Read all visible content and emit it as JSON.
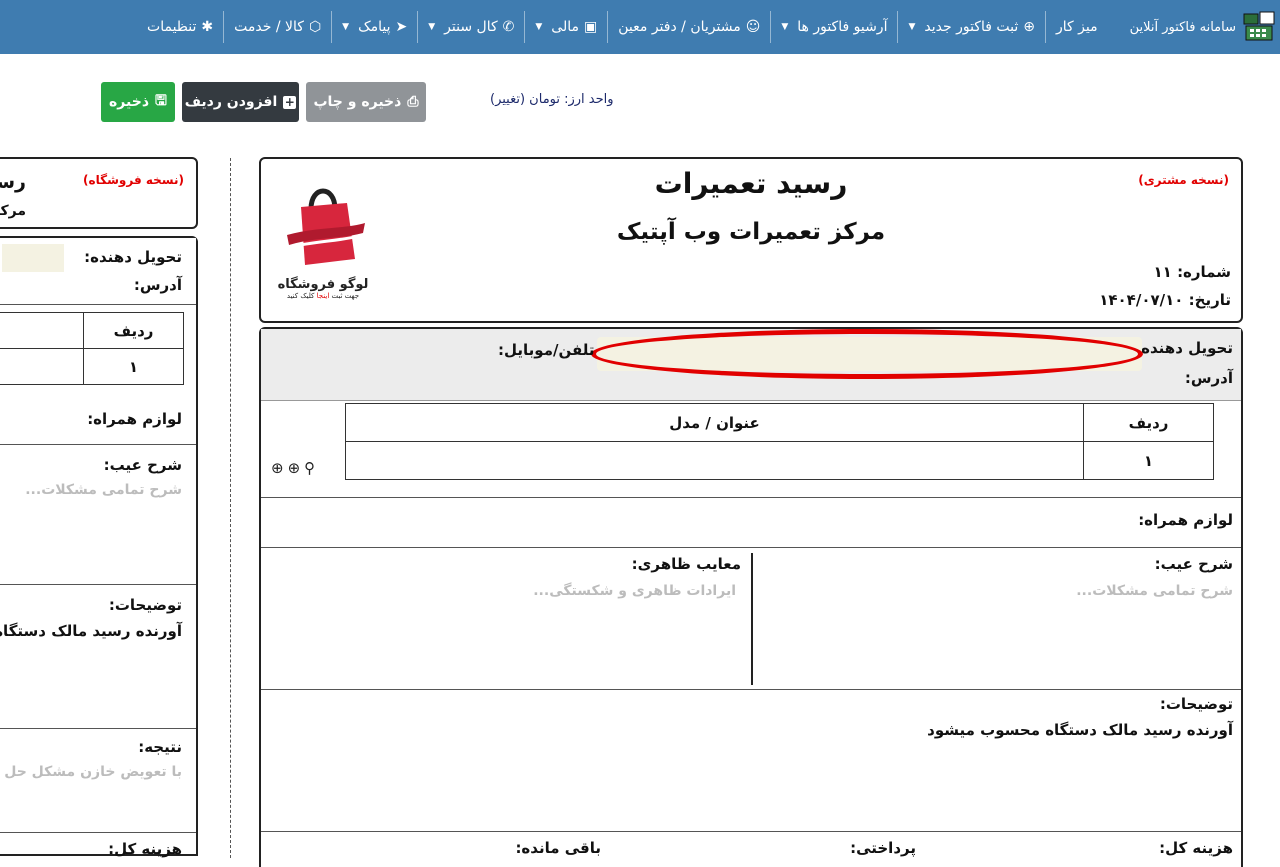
{
  "navbar": {
    "brand": "سامانه فاکتور آنلاین",
    "items": [
      {
        "label": "میز کار",
        "icon": "",
        "caret": false
      },
      {
        "label": "ثبت فاکتور جدید",
        "icon": "⊕",
        "caret": true
      },
      {
        "label": "آرشیو فاکتور ها",
        "icon": "",
        "caret": true
      },
      {
        "label": "مشتریان / دفتر معین",
        "icon": "☺",
        "caret": false
      },
      {
        "label": "مالی",
        "icon": "▣",
        "caret": true
      },
      {
        "label": "کال سنتر",
        "icon": "✆",
        "caret": true
      },
      {
        "label": "پیامک",
        "icon": "➤",
        "caret": true
      },
      {
        "label": "کالا / خدمت",
        "icon": "⬡",
        "caret": false
      },
      {
        "label": "تنظیمات",
        "icon": "✱",
        "caret": false
      }
    ]
  },
  "toolbar": {
    "save_label": "ذخیره",
    "add_row_label": "افزودن ردیف",
    "save_print_label": "ذخیره و چاپ",
    "currency_text": "واحد ارز: تومان (تغییر)"
  },
  "receipt": {
    "customer_copy": "(نسخه مشتری)",
    "title": "رسید تعمیرات",
    "subtitle": "مرکز تعمیرات وب آپتیک",
    "number_label": "شماره:",
    "number_value": "۱۱",
    "date_label": "تاریخ:",
    "date_value": "۱۴۰۴/۰۷/۱۰",
    "logo_text": "لوگو فروشگاه",
    "logo_sub_pre": "جهت ثبت",
    "logo_sub_link": "اینجا",
    "logo_sub_post": "کلیک کنید",
    "deliverer_label": "تحویل دهنده:",
    "phone_label": "تلفن/موبایل:",
    "address_label": "آدرس:",
    "table_headers": [
      "ردیف",
      "عنوان / مدل"
    ],
    "table_rows": [
      [
        "۱",
        ""
      ]
    ],
    "accessories_label": "لوازم همراه:",
    "defect_label": "شرح عیب:",
    "defect_placeholder": "شرح تمامی مشکلات...",
    "visual_label": "معایب ظاهری:",
    "visual_placeholder": "ایرادات ظاهری و شکستگی...",
    "notes_label": "توضیحات:",
    "notes_value": "آورنده رسید مالک دستگاه محسوب میشود",
    "bottom_labels": [
      "هزینه کل:",
      "پرداختی:",
      "باقی مانده:"
    ]
  },
  "left_copy": {
    "store_copy": "(نسخه فروشگاه)",
    "title": "رسید",
    "subtitle": "مرکز تع",
    "deliverer_label": "تحویل دهنده:",
    "address_label": "آدرس:",
    "row_header": "ردیف",
    "row_value": "۱",
    "accessories_label": "لوازم همراه:",
    "defect_label": "شرح عیب:",
    "defect_placeholder": "شرح تمامی مشکلات...",
    "notes_label": "توضیحات:",
    "notes_value": "آورنده رسید مالک دستگاه م",
    "result_label": "نتیجه:",
    "result_placeholder": "با تعویض خازن مشکل حل",
    "bottom_label": "هزینه کل:"
  }
}
